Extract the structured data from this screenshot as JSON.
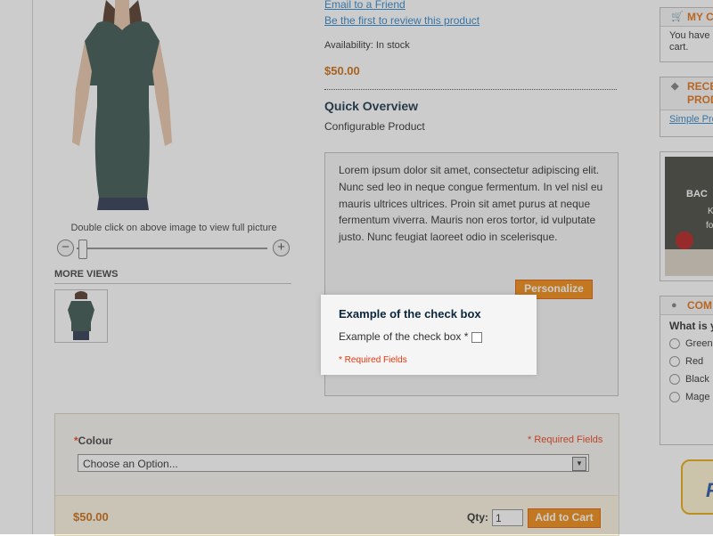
{
  "product": {
    "email_friend": "Email to a Friend",
    "review_link": "Be the first to review this product",
    "availability": "Availability: In stock",
    "price": "$50.00",
    "quick_overview_title": "Quick Overview",
    "quick_overview_text": "Configurable Product",
    "description": "Lorem ipsum dolor sit amet, consectetur adipiscing elit. Nunc sed leo in neque congue fermentum. In vel nisl eu mauris ultrices ultrices. Proin sit amet purus at neque fermentum viverra. Mauris non eros tortor, id vulputate justo. Nunc feugiat laoreet odio in scelerisque.",
    "personalize_label": "Personalize"
  },
  "gallery": {
    "zoom_hint": "Double click on above image to view full picture",
    "zoom_out": "−",
    "zoom_in": "+",
    "more_views": "MORE VIEWS"
  },
  "popup": {
    "title": "Example of the check box",
    "checkbox_label": "Example of the check box *",
    "required_note": "* Required Fields"
  },
  "options": {
    "colour_required_mark": "*",
    "colour_label": "Colour",
    "required_fields": "* Required Fields",
    "select_value": "Choose an Option...",
    "price": "$50.00",
    "qty_label": "Qty:",
    "qty_value": "1",
    "add_to_cart": "Add to Cart"
  },
  "sidebar": {
    "cart_title": "MY C",
    "cart_text_1": "You have",
    "cart_text_2": "cart.",
    "recent_title_1": "RECE",
    "recent_title_2": "PROD",
    "recent_link": "Simple Pro",
    "ad_text_1": "BAC",
    "ad_text_2": "K",
    "ad_text_3": "fo",
    "poll_title": "COM",
    "poll_question": "What is y",
    "poll_options": [
      "Green",
      "Red",
      "Black",
      "Mage"
    ],
    "promo_text": "F"
  },
  "colors": {
    "accent": "#f18200",
    "price": "#c76200",
    "link": "#1e7ec8",
    "required": "#eb340a"
  }
}
